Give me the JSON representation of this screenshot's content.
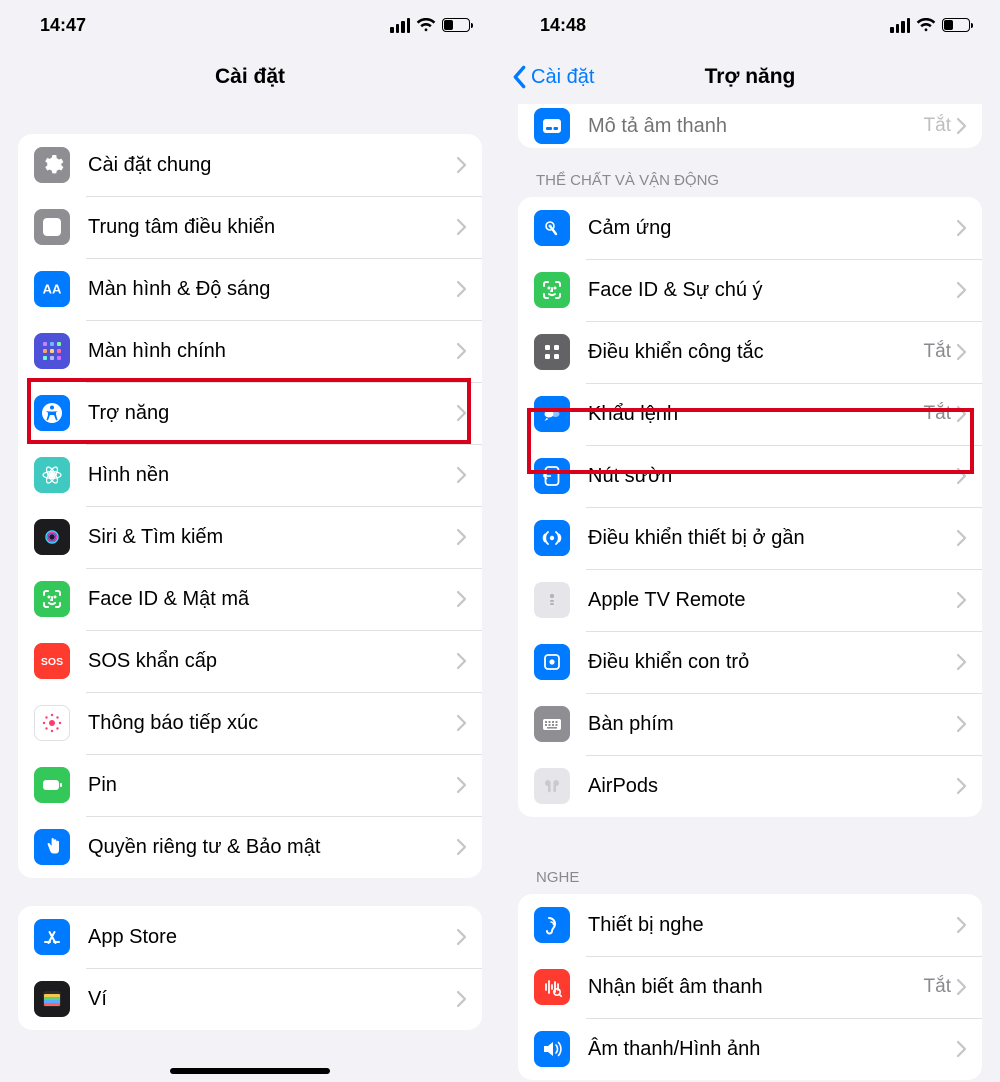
{
  "left": {
    "time": "14:47",
    "title": "Cài đặt",
    "group1": [
      {
        "label": "Cài đặt chung"
      },
      {
        "label": "Trung tâm điều khiển"
      },
      {
        "label": "Màn hình & Độ sáng"
      },
      {
        "label": "Màn hình chính"
      },
      {
        "label": "Trợ năng"
      },
      {
        "label": "Hình nền"
      },
      {
        "label": "Siri & Tìm kiếm"
      },
      {
        "label": "Face ID & Mật mã"
      },
      {
        "label": "SOS khẩn cấp"
      },
      {
        "label": "Thông báo tiếp xúc"
      },
      {
        "label": "Pin"
      },
      {
        "label": "Quyền riêng tư & Bảo mật"
      }
    ],
    "group2": [
      {
        "label": "App Store"
      },
      {
        "label": "Ví"
      }
    ]
  },
  "right": {
    "time": "14:48",
    "back": "Cài đặt",
    "title": "Trợ năng",
    "partial": {
      "label": "Mô tả âm thanh",
      "value": "Tắt"
    },
    "section1_header": "Thể chất và vận động",
    "section1": [
      {
        "label": "Cảm ứng",
        "value": ""
      },
      {
        "label": "Face ID & Sự chú ý",
        "value": ""
      },
      {
        "label": "Điều khiển công tắc",
        "value": "Tắt"
      },
      {
        "label": "Khẩu lệnh",
        "value": "Tắt"
      },
      {
        "label": "Nút sườn",
        "value": ""
      },
      {
        "label": "Điều khiển thiết bị ở gần",
        "value": ""
      },
      {
        "label": "Apple TV Remote",
        "value": ""
      },
      {
        "label": "Điều khiển con trỏ",
        "value": ""
      },
      {
        "label": "Bàn phím",
        "value": ""
      },
      {
        "label": "AirPods",
        "value": ""
      }
    ],
    "section2_header": "Nghe",
    "section2": [
      {
        "label": "Thiết bị nghe",
        "value": ""
      },
      {
        "label": "Nhận biết âm thanh",
        "value": "Tắt"
      },
      {
        "label": "Âm thanh/Hình ảnh",
        "value": ""
      }
    ]
  }
}
